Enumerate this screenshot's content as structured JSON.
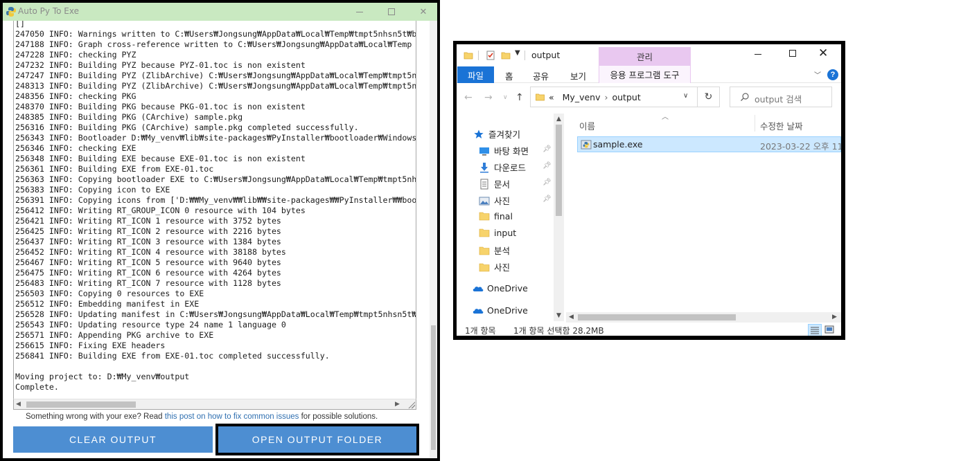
{
  "apte": {
    "title": "Auto Py To Exe",
    "log_lines": [
      "[]",
      "247050 INFO: Warnings written to C:₩Users₩Jongsung₩AppData₩Local₩Temp₩tmpt5nhsn5t₩b",
      "247188 INFO: Graph cross-reference written to C:₩Users₩Jongsung₩AppData₩Local₩Temp",
      "247228 INFO: checking PYZ",
      "247232 INFO: Building PYZ because PYZ-01.toc is non existent",
      "247247 INFO: Building PYZ (ZlibArchive) C:₩Users₩Jongsung₩AppData₩Local₩Temp₩tmpt5n",
      "248313 INFO: Building PYZ (ZlibArchive) C:₩Users₩Jongsung₩AppData₩Local₩Temp₩tmpt5n",
      "248356 INFO: checking PKG",
      "248370 INFO: Building PKG because PKG-01.toc is non existent",
      "248385 INFO: Building PKG (CArchive) sample.pkg",
      "256316 INFO: Building PKG (CArchive) sample.pkg completed successfully.",
      "256343 INFO: Bootloader D:₩My_venv₩lib₩site-packages₩PyInstaller₩bootloader₩Windows",
      "256346 INFO: checking EXE",
      "256348 INFO: Building EXE because EXE-01.toc is non existent",
      "256361 INFO: Building EXE from EXE-01.toc",
      "256363 INFO: Copying bootloader EXE to C:₩Users₩Jongsung₩AppData₩Local₩Temp₩tmpt5nh",
      "256383 INFO: Copying icon to EXE",
      "256391 INFO: Copying icons from ['D:₩₩My_venv₩₩lib₩₩site-packages₩₩PyInstaller₩₩boo",
      "256412 INFO: Writing RT_GROUP_ICON 0 resource with 104 bytes",
      "256421 INFO: Writing RT_ICON 1 resource with 3752 bytes",
      "256425 INFO: Writing RT_ICON 2 resource with 2216 bytes",
      "256437 INFO: Writing RT_ICON 3 resource with 1384 bytes",
      "256452 INFO: Writing RT_ICON 4 resource with 38188 bytes",
      "256467 INFO: Writing RT_ICON 5 resource with 9640 bytes",
      "256475 INFO: Writing RT_ICON 6 resource with 4264 bytes",
      "256483 INFO: Writing RT_ICON 7 resource with 1128 bytes",
      "256503 INFO: Copying 0 resources to EXE",
      "256512 INFO: Embedding manifest in EXE",
      "256528 INFO: Updating manifest in C:₩Users₩Jongsung₩AppData₩Local₩Temp₩tmpt5nhsn5t₩",
      "256543 INFO: Updating resource type 24 name 1 language 0",
      "256571 INFO: Appending PKG archive to EXE",
      "256615 INFO: Fixing EXE headers",
      "256841 INFO: Building EXE from EXE-01.toc completed successfully.",
      "",
      "Moving project to: D:₩My_venv₩output",
      "Complete."
    ],
    "help_prefix": "Something wrong with your exe? Read ",
    "help_link": "this post on how to fix common issues",
    "help_suffix": " for possible solutions.",
    "clear_button": "CLEAR OUTPUT",
    "open_button": "OPEN OUTPUT FOLDER",
    "button_color": "#4d8ed2",
    "titlebar_color": "#c9e9c1"
  },
  "explorer": {
    "title": "output",
    "manage_tab": "관리",
    "ribbon": {
      "file": "파일",
      "home": "홈",
      "share": "공유",
      "view": "보기",
      "app_tools": "응용 프로그램 도구"
    },
    "address": {
      "prefix": "«",
      "segments": [
        "My_venv",
        "output"
      ]
    },
    "search_placeholder": "output 검색",
    "nav": {
      "quick_access": "즐겨찾기",
      "pinned": [
        {
          "label": "바탕 화면",
          "icon": "desktop-icon"
        },
        {
          "label": "다운로드",
          "icon": "download-icon"
        },
        {
          "label": "문서",
          "icon": "document-icon"
        },
        {
          "label": "사진",
          "icon": "pictures-icon"
        }
      ],
      "folders": [
        "final",
        "input",
        "분석",
        "사진"
      ],
      "onedrive": [
        "OneDrive",
        "OneDrive"
      ]
    },
    "columns": {
      "name": "이름",
      "date": "수정한 날짜"
    },
    "files": [
      {
        "name": "sample.exe",
        "date": "2023-03-22 오후 11:"
      }
    ],
    "status": {
      "count": "1개 항목",
      "selected": "1개 항목 선택함 28.2MB"
    },
    "accent_color": "#1a73d6",
    "manage_color": "#e9c8f0"
  }
}
